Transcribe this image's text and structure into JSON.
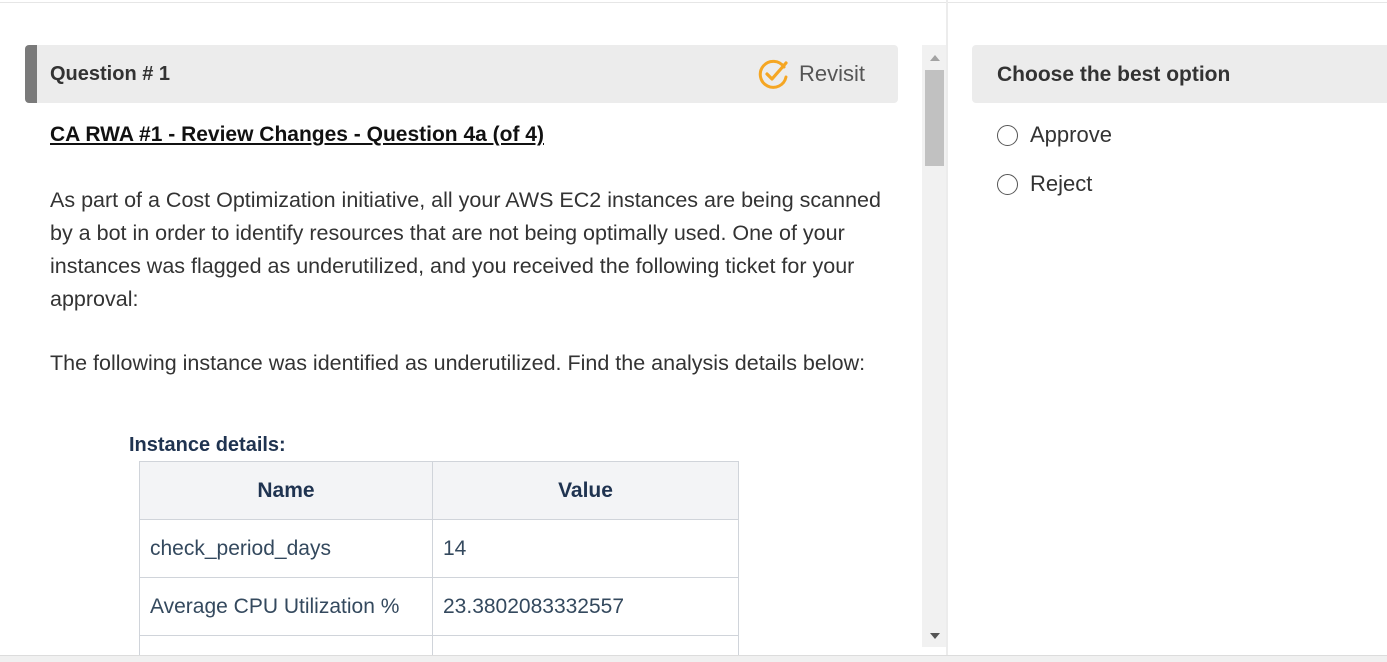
{
  "question": {
    "header_title": "Question # 1",
    "revisit_label": "Revisit",
    "subtitle": "CA RWA #1 - Review Changes - Question 4a (of 4)",
    "paragraphs": [
      "As part of a Cost Optimization initiative, all your AWS EC2 instances are being scanned by a bot in order to identify resources that are not being optimally used. One of your instances was flagged as underutilized, and you received the following ticket for your approval:",
      "The following instance was identified as underutilized. Find the analysis details below:"
    ],
    "instance_heading": "Instance details:",
    "table": {
      "headers": [
        "Name",
        "Value"
      ],
      "rows": [
        [
          "check_period_days",
          "14"
        ],
        [
          "Average CPU Utilization %",
          "23.3802083332557"
        ],
        [
          "",
          ""
        ]
      ]
    }
  },
  "options_panel": {
    "title": "Choose the best option",
    "options": [
      "Approve",
      "Reject"
    ]
  },
  "colors": {
    "header_bg": "#ececec",
    "header_accent": "#7a7a7a",
    "revisit_icon": "#f5a623",
    "table_text": "#34495e",
    "table_header_text": "#1f3350"
  },
  "icons": {
    "revisit": "pencil-check-icon"
  }
}
